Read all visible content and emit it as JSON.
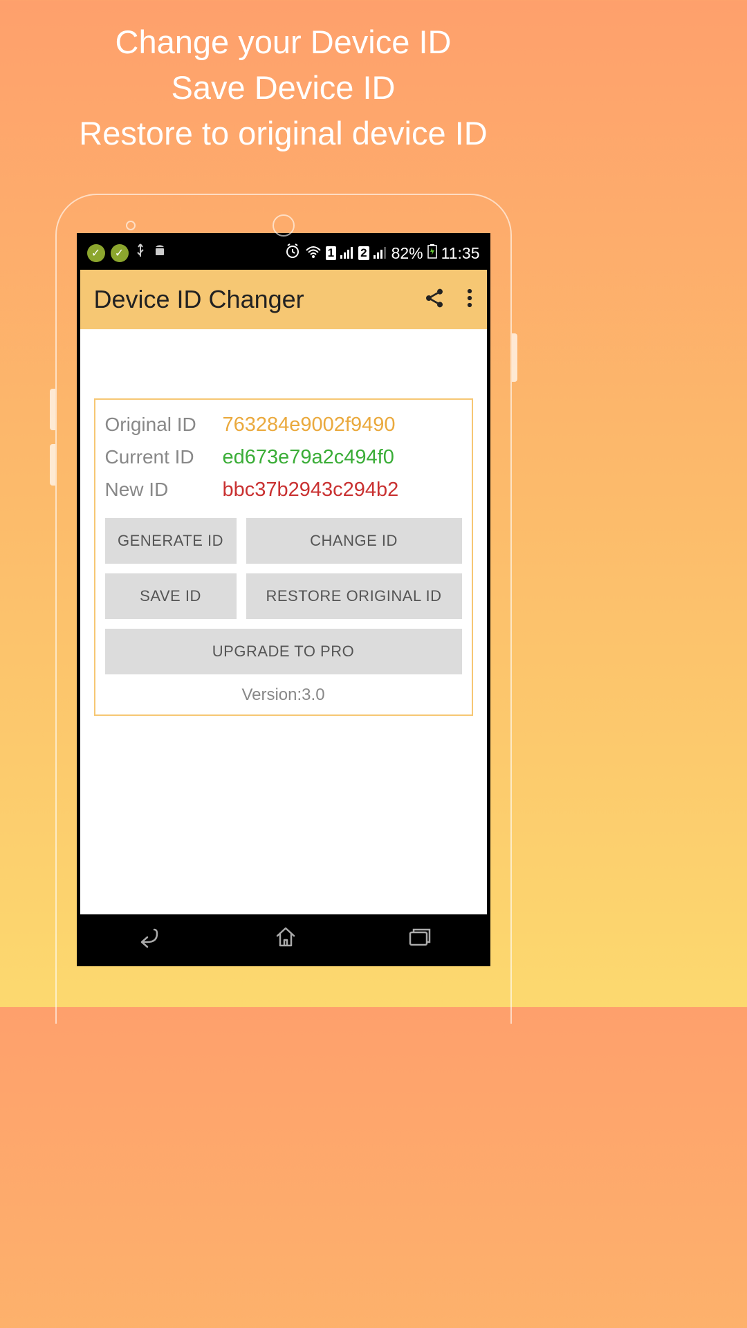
{
  "promo": {
    "line1": "Change your Device ID",
    "line2": "Save Device ID",
    "line3": "Restore to original device ID"
  },
  "status_bar": {
    "battery_percent": "82%",
    "time": "11:35",
    "sim_slot": "2"
  },
  "app_bar": {
    "title": "Device ID Changer"
  },
  "ids": {
    "original_label": "Original ID",
    "original_value": "763284e9002f9490",
    "current_label": "Current ID",
    "current_value": "ed673e79a2c494f0",
    "new_label": "New ID",
    "new_value": "bbc37b2943c294b2"
  },
  "buttons": {
    "generate": "GENERATE ID",
    "change": "CHANGE ID",
    "save": "SAVE ID",
    "restore": "RESTORE ORIGINAL ID",
    "upgrade": "UPGRADE TO PRO"
  },
  "version_label": "Version:3.0"
}
